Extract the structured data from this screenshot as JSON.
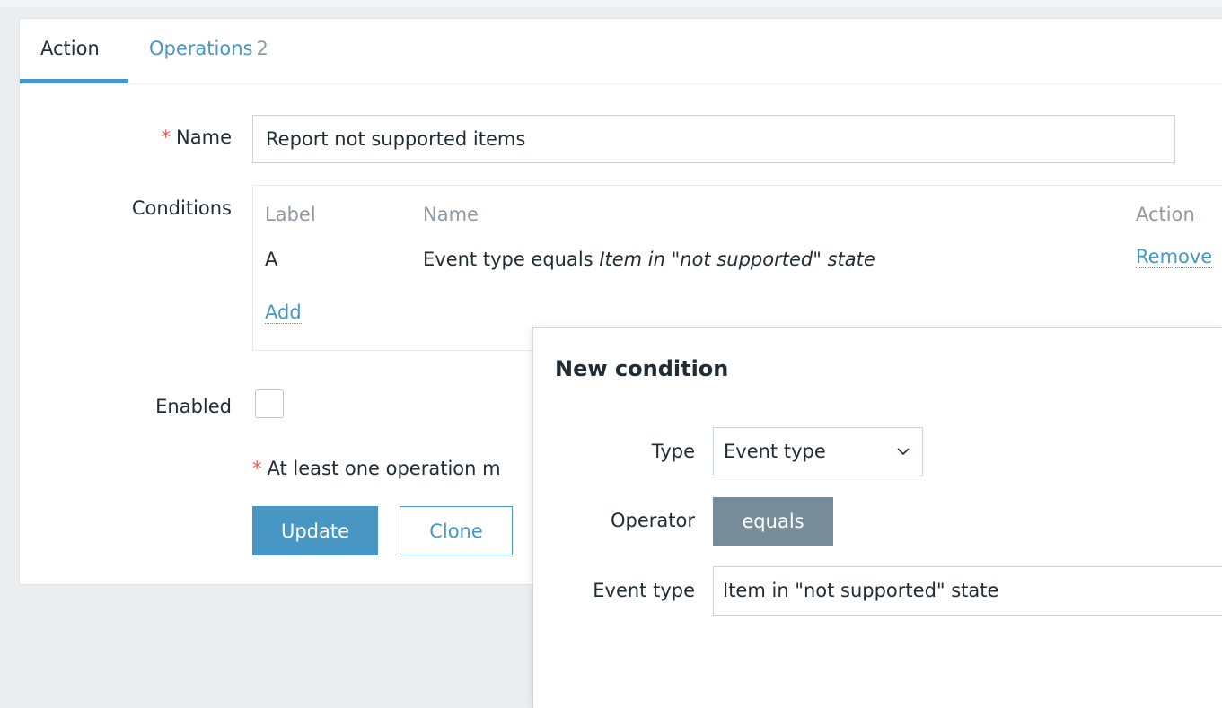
{
  "tabs": {
    "action_label": "Action",
    "operations_label": "Operations",
    "operations_count": "2"
  },
  "form": {
    "required_mark": "*",
    "name_label": "Name",
    "name_value": "Report not supported items",
    "conditions_label": "Conditions",
    "conditions": {
      "headers": {
        "label": "Label",
        "name": "Name",
        "action": "Action"
      },
      "rows": [
        {
          "label": "A",
          "name_prefix": "Event type equals ",
          "name_value": "Item in \"not supported\" state",
          "action": "Remove"
        }
      ],
      "add_label": "Add"
    },
    "enabled_label": "Enabled",
    "enabled_checked": false,
    "note_text": "At least one operation m",
    "update_label": "Update",
    "clone_label": "Clone"
  },
  "dialog": {
    "title": "New condition",
    "type_label": "Type",
    "type_value": "Event type",
    "operator_label": "Operator",
    "operator_value": "equals",
    "event_type_label": "Event type",
    "event_type_value": "Item in \"not supported\" state"
  },
  "colors": {
    "accent": "#4796c4",
    "required": "#e45959",
    "operator_pill": "#768d99",
    "background": "#ebeef0"
  },
  "icons": {
    "select_arrow": "chevron-down-icon"
  }
}
